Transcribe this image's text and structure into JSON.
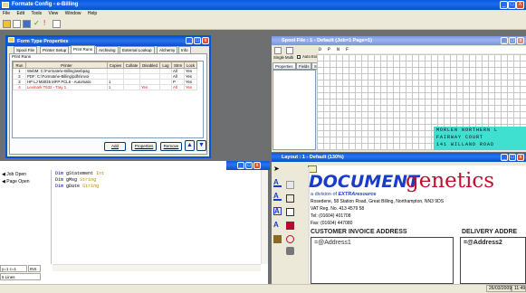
{
  "app": {
    "title": "Formate Config - e-Billing",
    "menu": [
      "File",
      "Edit",
      "Tools",
      "View",
      "Window",
      "Help"
    ],
    "minimize": "_",
    "maximize": "□",
    "close": "X"
  },
  "dialog": {
    "title": "Form Type Properties",
    "tabs": [
      "Spool File",
      "Printer Setup",
      "Print Runs",
      "Archiving",
      "External Lookup",
      "Alchemy",
      "Info"
    ],
    "active_tab": "Print Runs",
    "group_label": "Print Runs",
    "columns": [
      "Run",
      "Printer",
      "Copies",
      "Collate",
      "Disabled",
      "Log",
      "Strm",
      "Lock"
    ],
    "rows": [
      {
        "run": "1",
        "printer": "WebM: C:\\Formate\\e-Billing\\webpag",
        "copies": "",
        "collate": "",
        "disabled": "",
        "log": "",
        "strm": "All",
        "lock": "Yes",
        "red": false
      },
      {
        "run": "2",
        "printer": "PDF: C:\\Formate\\e-Billing\\pdfs\\invoi",
        "copies": "",
        "collate": "",
        "disabled": "",
        "log": "",
        "strm": "All",
        "lock": "Yes",
        "red": false
      },
      {
        "run": "3",
        "printer": "HP LJ M3035 MFP PCL6 - Automatic",
        "copies": "1",
        "collate": "",
        "disabled": "",
        "log": "",
        "strm": "P",
        "lock": "Yes",
        "red": false
      },
      {
        "run": "4",
        "printer": "Lexmark T632 - Tray 1",
        "copies": "1",
        "collate": "",
        "disabled": "Yes",
        "log": "",
        "strm": "All",
        "lock": "Yes",
        "red": true
      }
    ],
    "buttons": {
      "add": "Add",
      "properties": "Properties",
      "remove": "Remove"
    },
    "up_arrow": "▲",
    "down_arrow": "▼"
  },
  "spool": {
    "title": "Spool File : 1 - Default (Job=1 Page=1)",
    "single": "Single",
    "multi": "Multi",
    "autoexit": "Auto Exit",
    "tabs": [
      "Properties",
      "Fields",
      "Selected"
    ],
    "header_text": "D  P    N  F",
    "lines": [
      "MORLEN  NORTHERN  L",
      "FAIRWAY  COURT",
      "141  WILLAND  ROAD"
    ]
  },
  "layout": {
    "title": "Layout : 1 - Default (130%)",
    "logo_main": "DOCUMENT",
    "logo_script": "genetics",
    "division": "a division of",
    "division_brand": "EXTRAresource",
    "address": "Rosedene, 58 Station Road, Great Billing, Northampton, NN3 9DS",
    "vat": "VAT Reg. No. 413 4579 58",
    "tel": "Tel: (01604) 401708",
    "fax": "Fax: (01604) 447080",
    "customer_heading": "CUSTOMER INVOICE ADDRESS",
    "delivery_heading": "DELIVERY ADDRE",
    "customer_field": "=@Address1",
    "delivery_field": "=@Address2"
  },
  "code": {
    "tree": [
      "Job Open",
      "Page Open"
    ],
    "lines": [
      {
        "kw": "Dim",
        "name": "gStatement",
        "type": "Int"
      },
      {
        "kw": "Dim",
        "name": "gMsg",
        "type": "String"
      },
      {
        "kw": "Dim",
        "name": "gDate",
        "type": "String"
      }
    ],
    "position": "y=1 c=1",
    "ins": "INS",
    "lines_count": "5 Lines"
  },
  "status": {
    "date": "26/03/2009",
    "time": "11:49"
  }
}
